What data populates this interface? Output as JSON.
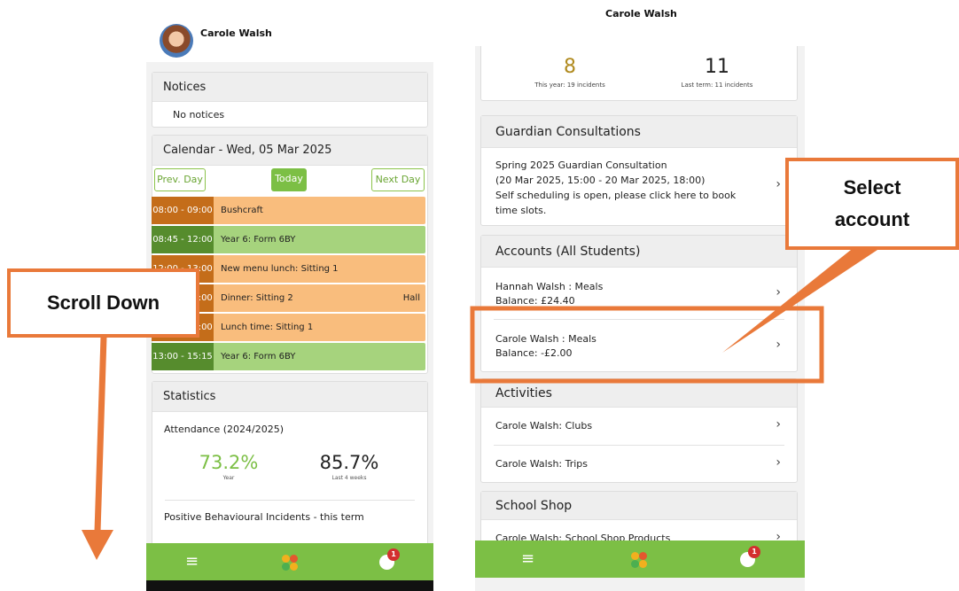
{
  "left_screen": {
    "user_name": "Carole Walsh",
    "notices": {
      "title": "Notices",
      "text": "No notices"
    },
    "calendar": {
      "title": "Calendar - Wed, 05 Mar 2025",
      "prev_label": "Prev. Day",
      "today_label": "Today",
      "next_label": "Next Day",
      "events": [
        {
          "time": "08:00 - 09:00",
          "name": "Bushcraft",
          "location": ""
        },
        {
          "time": "08:45 - 12:00",
          "name": "Year 6: Form 6BY",
          "location": ""
        },
        {
          "time": "12:00 - 13:00",
          "name": "New menu lunch: Sitting 1",
          "location": ""
        },
        {
          "time": "12:00 - 13:00",
          "name": "Dinner: Sitting 2",
          "location": "Hall"
        },
        {
          "time": "12:00 - 13:00",
          "name": "Lunch time: Sitting 1",
          "location": ""
        },
        {
          "time": "13:00 - 15:15",
          "name": "Year 6: Form 6BY",
          "location": ""
        }
      ]
    },
    "statistics": {
      "title": "Statistics",
      "attendance_label": "Attendance (2024/2025)",
      "year_value": "73.2%",
      "year_caption": "Year",
      "weeks_value": "85.7%",
      "weeks_caption": "Last 4 weeks",
      "behaviour_label": "Positive Behavioural Incidents - this term"
    },
    "nav_badge": "1"
  },
  "right_screen": {
    "user_name": "Carole Walsh",
    "incidents": {
      "this_year_value": "8",
      "this_year_caption": "This year: 19 incidents",
      "last_term_value": "11",
      "last_term_caption": "Last term: 11 incidents"
    },
    "consultations": {
      "title": "Guardian Consultations",
      "lines": [
        "Spring 2025 Guardian Consultation",
        "(20 Mar 2025, 15:00 - 20 Mar 2025, 18:00)",
        "Self scheduling is open, please click here to book",
        "time slots."
      ]
    },
    "accounts": {
      "title": "Accounts  (All Students)",
      "items": [
        {
          "name": "Hannah Walsh : Meals",
          "balance": "Balance: £24.40"
        },
        {
          "name": "Carole Walsh : Meals",
          "balance": "Balance: -£2.00"
        }
      ]
    },
    "activities": {
      "title": "Activities",
      "items": [
        "Carole Walsh: Clubs",
        "Carole Walsh: Trips"
      ]
    },
    "school_shop": {
      "title": "School Shop",
      "items": [
        "Carole Walsh: School Shop Products"
      ]
    },
    "nav_badge": "1"
  },
  "annotations": {
    "scroll_down": "Scroll Down",
    "select_account_line1": "Select",
    "select_account_line2": "account",
    "accent_color": "#e9793a"
  },
  "colors": {
    "nav_green": "#7cbf45",
    "event_orange": "#f9bd7d",
    "event_green": "#a6d37d",
    "stat_green": "#7cbf45",
    "stat_gold": "#b08a1e",
    "badge_red": "#d32f2f"
  },
  "icons": [
    "hamburger-menu-icon",
    "flower-logo-icon",
    "user-icon",
    "chevron-right-icon"
  ]
}
